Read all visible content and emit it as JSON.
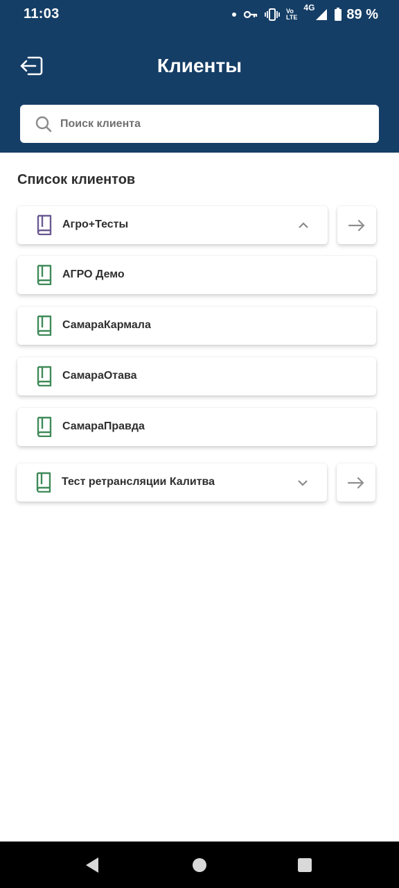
{
  "status_bar": {
    "time": "11:03",
    "volte_top": "Vo",
    "volte_bottom": "LTE",
    "network": "4G",
    "battery": "89 %"
  },
  "header": {
    "title": "Клиенты",
    "back_icon": "logout-arrow-icon",
    "background_color": "#153e66"
  },
  "search": {
    "placeholder": "Поиск клиента",
    "value": ""
  },
  "clients_section": {
    "title": "Список клиентов",
    "items": [
      {
        "label": "Агро+Тесты",
        "icon": "book-icon",
        "icon_color": "#6b5a92",
        "expandable": true,
        "expanded": true
      },
      {
        "label": "АГРО Демо",
        "icon": "book-icon",
        "icon_color": "#3f8a59",
        "expandable": false
      },
      {
        "label": "СамараКармала",
        "icon": "book-icon",
        "icon_color": "#3f8a59",
        "expandable": false
      },
      {
        "label": "СамараОтава",
        "icon": "book-icon",
        "icon_color": "#3f8a59",
        "expandable": false
      },
      {
        "label": "СамараПравда",
        "icon": "book-icon",
        "icon_color": "#3f8a59",
        "expandable": false
      },
      {
        "label": "Тест ретрансляции Калитва",
        "icon": "book-icon",
        "icon_color": "#3f8a59",
        "expandable": true,
        "expanded": false
      }
    ]
  },
  "nav_bar": {
    "buttons": [
      "back-triangle-icon",
      "home-circle-icon",
      "recents-square-icon"
    ]
  }
}
